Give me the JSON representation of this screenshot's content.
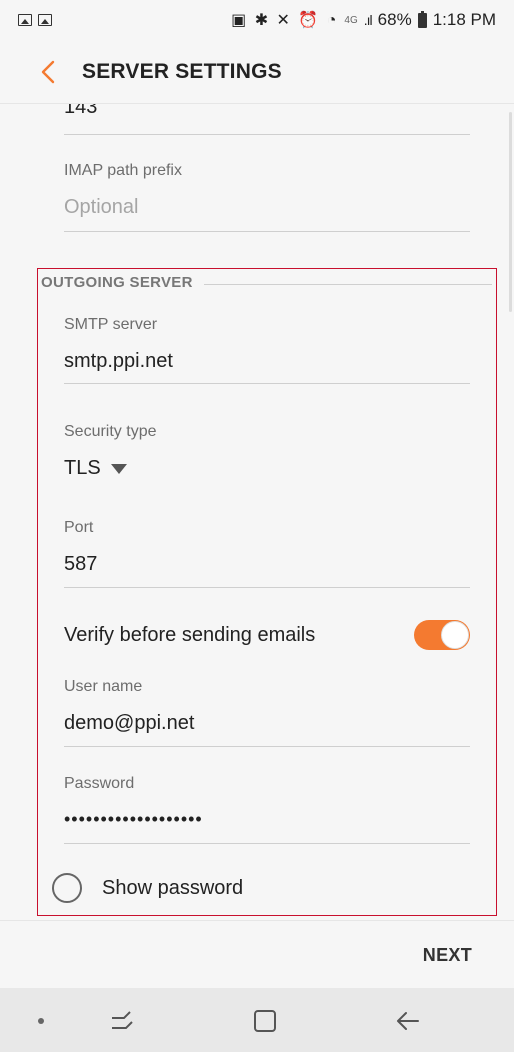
{
  "status_bar": {
    "battery": "68%",
    "time": "1:18 PM",
    "network": "4G"
  },
  "header": {
    "title": "SERVER SETTINGS"
  },
  "incoming": {
    "port_value": "143",
    "imap_prefix_label": "IMAP path prefix",
    "imap_prefix_placeholder": "Optional"
  },
  "outgoing": {
    "section_title": "OUTGOING SERVER",
    "smtp_label": "SMTP server",
    "smtp_value": "smtp.ppi.net",
    "security_label": "Security type",
    "security_value": "TLS",
    "port_label": "Port",
    "port_value": "587",
    "verify_label": "Verify before sending emails",
    "verify_on": true,
    "username_label": "User name",
    "username_value": "demo@ppi.net",
    "password_label": "Password",
    "password_value": "•••••••••••••••••••",
    "show_password_label": "Show password"
  },
  "footer": {
    "next_label": "NEXT"
  },
  "colors": {
    "accent": "#f47a30",
    "highlight_border": "#c8102e"
  },
  "icons": {
    "back": "chevron-left-icon",
    "nav_recents": "recents-icon",
    "nav_home": "home-icon",
    "nav_back": "back-arrow-icon"
  }
}
